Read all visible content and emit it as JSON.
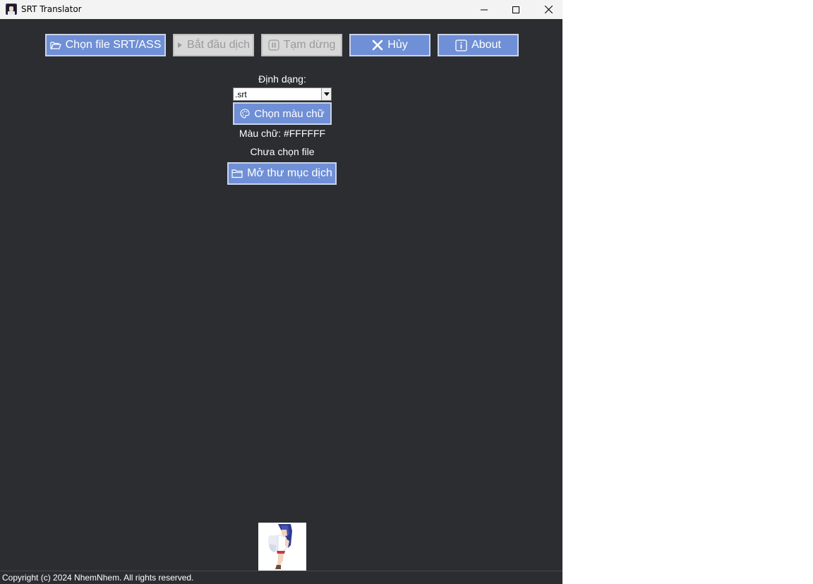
{
  "window": {
    "title": "SRT Translator"
  },
  "toolbar": {
    "choose_file_label": "Chọn file SRT/ASS",
    "start_label": "Bắt đầu dịch",
    "pause_label": "Tạm dừng",
    "cancel_label": "Hủy",
    "about_label": "About"
  },
  "format": {
    "label": "Định dạng:",
    "selected": ".srt"
  },
  "color": {
    "button_label": "Chọn màu chữ",
    "current_text": "Màu chữ: #FFFFFF",
    "value": "#FFFFFF"
  },
  "file_status": "Chưa chọn file",
  "open_folder_label": "Mở thư mục dịch",
  "footer": {
    "copyright": "Copyright (c) 2024 NhemNhem. All rights reserved."
  },
  "icons": {
    "folder": "folder-open-icon",
    "play": "play-icon",
    "pause": "pause-icon",
    "close": "x-icon",
    "info": "info-icon",
    "palette": "palette-icon"
  },
  "colors": {
    "background": "#2b2d31",
    "button": "#6f8fd6",
    "button_disabled": "#d8d8d8"
  }
}
